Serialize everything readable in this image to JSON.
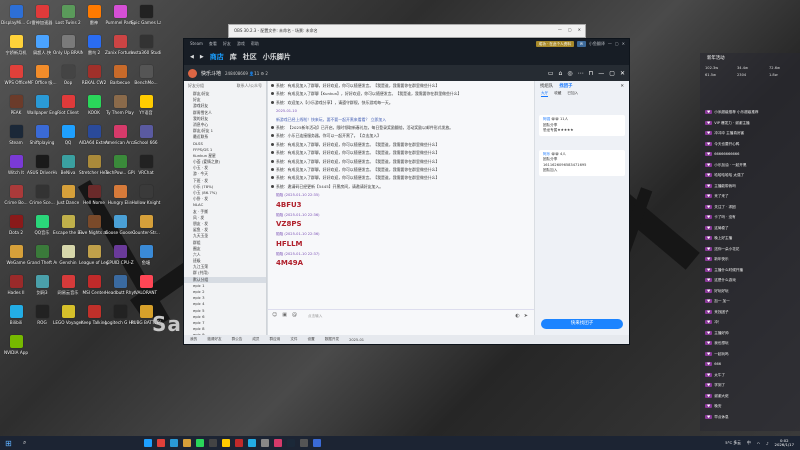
{
  "desktop": {
    "wallpaper_text": "Sa",
    "icons": [
      {
        "label": "DisplayMi... Center",
        "color": "#2d6fd6"
      },
      {
        "label": "雷神加速器",
        "color": "#e03a3a"
      },
      {
        "label": "Lost Twins 2",
        "color": "#5a9a5a"
      },
      {
        "label": "雷神",
        "color": "#ff7a00"
      },
      {
        "label": "Pummel Party",
        "color": "#d64fd6"
      },
      {
        "label": "Epic Games Launcher",
        "color": "#222"
      },
      {
        "label": "宁娇新月机",
        "color": "#ffd23a"
      },
      {
        "label": "屑超人.快",
        "color": "#4aa3ff"
      },
      {
        "label": "Only Up BRAINR...",
        "color": "#7a7a7a"
      },
      {
        "label": "雷鸟 2",
        "color": "#2a6cf2"
      },
      {
        "label": "Zanix Fortune...",
        "color": "#c44"
      },
      {
        "label": "Insta360 Studio",
        "color": "#333"
      },
      {
        "label": "WPS Office",
        "color": "#e0403a"
      },
      {
        "label": "MF Office 吸...",
        "color": "#f28c2a"
      },
      {
        "label": "Oop",
        "color": "#444"
      },
      {
        "label": "REKAL CW2",
        "color": "#a0302a"
      },
      {
        "label": "Barbecue",
        "color": "#c86a2a"
      },
      {
        "label": "BenchMo...",
        "color": "#555"
      },
      {
        "label": "PEAK",
        "color": "#6b3b2a"
      },
      {
        "label": "Wallpaper Engine",
        "color": "#2a9ad6"
      },
      {
        "label": "Riot Client",
        "color": "#e03a3a"
      },
      {
        "label": "KOOK",
        "color": "#2ad65a"
      },
      {
        "label": "Ty Them Play",
        "color": "#8a6a4a"
      },
      {
        "label": "YY语音",
        "color": "#ffcc00"
      },
      {
        "label": "Steam",
        "color": "#1b2838"
      },
      {
        "label": "Shiftplaying",
        "color": "#3a6ad6"
      },
      {
        "label": "QQ",
        "color": "#1ea0ff"
      },
      {
        "label": "AIDA64 Extreme",
        "color": "#2a4a9a"
      },
      {
        "label": "American Arcadia",
        "color": "#d63a6a"
      },
      {
        "label": "School 666",
        "color": "#5a5aa0"
      },
      {
        "label": "Witch It",
        "color": "#7a3ad6"
      },
      {
        "label": "ASUS DriverHub",
        "color": "#1a1a1a"
      },
      {
        "label": "BeNiva",
        "color": "#3aa0a0"
      },
      {
        "label": "Stretcher Heaven",
        "color": "#aa8a3a"
      },
      {
        "label": "TechPow... GPU-Z",
        "color": "#3a8a3a"
      },
      {
        "label": "VRChat",
        "color": "#222"
      },
      {
        "label": "Crime Bo...",
        "color": "#aa3a3a"
      },
      {
        "label": "Crime Sce...",
        "color": "#333"
      },
      {
        "label": "Just Dance",
        "color": "#d6a03a"
      },
      {
        "label": "Hell Nome",
        "color": "#6a2a2a"
      },
      {
        "label": "Hungry Elin",
        "color": "#d67a3a"
      },
      {
        "label": "Hollow Knight",
        "color": "#3a3a3a"
      },
      {
        "label": "Dota 2",
        "color": "#8a1a1a"
      },
      {
        "label": "QQ音乐",
        "color": "#2ad67a"
      },
      {
        "label": "Escape the Backrooms",
        "color": "#c0b04a"
      },
      {
        "label": "Five Nights at Freddy's",
        "color": "#7a4a2a"
      },
      {
        "label": "Goose Goose Duck",
        "color": "#4aa0d6"
      },
      {
        "label": "Counter-Str...",
        "color": "#d6a03a"
      },
      {
        "label": "WeGame",
        "color": "#d6a03a"
      },
      {
        "label": "Grand Theft Auto V",
        "color": "#3a7a3a"
      },
      {
        "label": "Genshin",
        "color": "#d6d6aa"
      },
      {
        "label": "League of Legends",
        "color": "#c0a04a"
      },
      {
        "label": "CPUID CPU-Z",
        "color": "#6a3a9a"
      },
      {
        "label": "鱼塘",
        "color": "#3a8ad6"
      },
      {
        "label": "Hades II",
        "color": "#9a2a2a"
      },
      {
        "label": "剑网3",
        "color": "#4aa0aa"
      },
      {
        "label": "网易云音乐",
        "color": "#d63a3a"
      },
      {
        "label": "MSI Center",
        "color": "#c02a2a"
      },
      {
        "label": "Headbutt Rhythm",
        "color": "#3a6aa0"
      },
      {
        "label": "VALORANT",
        "color": "#ff4655"
      },
      {
        "label": "Bilibili",
        "color": "#23ade5"
      },
      {
        "label": "ROG",
        "color": "#222"
      },
      {
        "label": "LEGO Voyagers",
        "color": "#d6c02a"
      },
      {
        "label": "Keep Talking",
        "color": "#c0302a"
      },
      {
        "label": "Logitech G HUB",
        "color": "#222"
      },
      {
        "label": "PUBG BATTLEGR...",
        "color": "#d6a02a"
      },
      {
        "label": "NVIDIA App",
        "color": "#76b900"
      }
    ]
  },
  "back_window": {
    "title": "OBS 30.2.3 - 配置文件: 未命名 - 场景: 未命名"
  },
  "steam": {
    "top_menu": [
      "Steam",
      "查看",
      "好友",
      "游戏",
      "帮助"
    ],
    "top_badge": "成功 · 在此个人资料",
    "top_user": "小鱼翻译",
    "nav": {
      "back": "◀",
      "forward": "▶",
      "store": "商店",
      "library": "库",
      "community": "社区",
      "user": "小乐脚片"
    },
    "chat_title": "快乐斗地",
    "chat_stats": "248408669  👤11  ⚙ 2"
  },
  "contacts": {
    "header_left": "好友分组",
    "header_right": "联系人/公众号",
    "rows": [
      "群友/好友",
      "好友",
      "游戏好友",
      "群周雪艺人",
      "我的好友",
      "消息中心",
      "群友/好友 1",
      "最近联系",
      "DLSS",
      "FFPS/GS 1",
      "Kunkun 星星",
      "小荟 (爱情之旅)",
      "小玉 · 发",
      "游 · 今天",
      "下班 · 发",
      "小乐 (78%)",
      "小玉 (86.7%)",
      "小卧 · 发",
      "NLAC",
      "友 · 手撕",
      "风 · 发",
      "朋友 · 发",
      "鲨鱼 · 发",
      "九天玉圣",
      "群组",
      "圈友",
      "六人",
      "班级",
      "九江玉荣",
      "群 (共用)",
      "默认分组",
      "epic 1",
      "epic 2",
      "epic 3",
      "epic 4",
      "epic 5",
      "epic 6",
      "epic 7",
      "epic 8",
      "epic 9",
      "epic 10",
      "epic 11"
    ]
  },
  "messages": [
    {
      "t": "bullet",
      "text": "系统：有成员加入了群聊，好好欢迎，你可以随便发言。【我是谁，我需要你在群里做些什么】"
    },
    {
      "t": "bullet",
      "text": "系统：有成员加入了群聊【Kunkun】，好好欢迎，你可以随便发言。【我是谁，我需要你在群里做些什么】"
    },
    {
      "t": "bullet",
      "text": "系统：欢迎加入【小乐游戏分享】，请遵守群规，快乐游戏每一天。"
    },
    {
      "t": "name",
      "text": "2025-01-10"
    },
    {
      "t": "purple",
      "text": "新游戏已经上线啦！快来玩，要不要一起开黑来看看？ 立即加入"
    },
    {
      "t": "bullet",
      "text": "系统：【2025新年活动】已开启，限时领取新春礼包，每日登录奖励翻倍，活动奖励以邮件形式发放。"
    },
    {
      "t": "bullet",
      "text": "系统：小乐已连接服务器，你可以一起开黑了。【点击加入】"
    },
    {
      "t": "bullet",
      "text": "系统：有成员加入了群聊，好好欢迎，你可以随便发言。【我是谁，我需要你在群里做些什么】"
    },
    {
      "t": "bullet",
      "text": "系统：有成员加入了群聊，好好欢迎，你可以随便发言。【我是谁，我需要你在群里做些什么】"
    },
    {
      "t": "bullet",
      "text": "系统：有成员加入了群聊，好好欢迎，你可以随便发言。【我是谁，我需要你在群里做些什么】"
    },
    {
      "t": "bullet",
      "text": "系统：有成员加入了群聊，好好欢迎，你可以随便发言。【我是谁，我需要你在群里做些什么】"
    },
    {
      "t": "bullet",
      "text": "系统：有成员加入了群聊，好好欢迎，你可以随便发言。【我是谁，我需要你在群里做些什么】"
    },
    {
      "t": "bullet",
      "text": "系统：邀请码已经更新【5445】开黑房间，请邀请好友加入。"
    },
    {
      "t": "name",
      "text": "陌陌 (2025-01-10 22:35)"
    },
    {
      "t": "code",
      "text": "4BFU3"
    },
    {
      "t": "name",
      "text": "陌陌 (2025-01-10 22:36)"
    },
    {
      "t": "code",
      "text": "VZ8PS"
    },
    {
      "t": "name",
      "text": "陌陌 (2025-01-10 22:36)"
    },
    {
      "t": "code",
      "text": "HFLLM"
    },
    {
      "t": "name",
      "text": "陌陌 (2025-01-10 22:37)"
    },
    {
      "t": "code",
      "text": "4M49A"
    }
  ],
  "compose": {
    "placeholder": "点击输入"
  },
  "find_group": {
    "title": "找组队",
    "header_active": "找团子",
    "tabs": [
      "大厅",
      "收藏",
      "已加入"
    ],
    "card1_name": "阿强",
    "card1_tags": "😀😀 11人",
    "card1_line1": "团队分享",
    "card1_line2": "恐龙专属★★★★★",
    "card2_name": "阿乐",
    "card2_tags": "😀😀 4人",
    "card2_line1": "团队分享",
    "card2_line2": "1611626096583471695",
    "card2_line3": "团队加入",
    "join_button": "快来找团子"
  },
  "chat_footer": [
    "我的",
    "邀请好友",
    "群公告",
    "成员",
    "群应用",
    "文件",
    "设置",
    "数据开发",
    "2025-01"
  ],
  "right_panel": {
    "title": "新年活动",
    "stats": [
      "102.3w",
      "34.4w",
      "72.6w",
      "61.5w",
      "2304",
      "1.8w"
    ],
    "danmu": [
      "小米超级推荐 小乐超级推荐",
      "VIP 爆发力 · 谢谢主播",
      "冲冲冲 主播真厉害",
      "今天也要开心鸭",
      "66666666666",
      "小乐加油 · 一起开黑",
      "哈哈哈哈哈 太强了",
      "主播能带我吗",
      "来了来了",
      "关注了 · 求团",
      "卡了吗 · 没有",
      "这局稳了",
      "晚上好主播",
      "送你一朵小花花",
      "新年快乐",
      "主播什么时候开播",
      "这是什么游戏",
      "好玩好玩",
      "加一 加一",
      "来找团子",
      "冲！",
      "主播好帅",
      "我也想玩",
      "一起玩吗",
      "666",
      "太牛了",
      "学到了",
      "谢谢大佬",
      "晚安",
      "早点休息"
    ]
  },
  "taskbar": {
    "time": "0:02",
    "date": "2026/1/17",
    "lang": "中",
    "weather": "5°C 多云"
  }
}
